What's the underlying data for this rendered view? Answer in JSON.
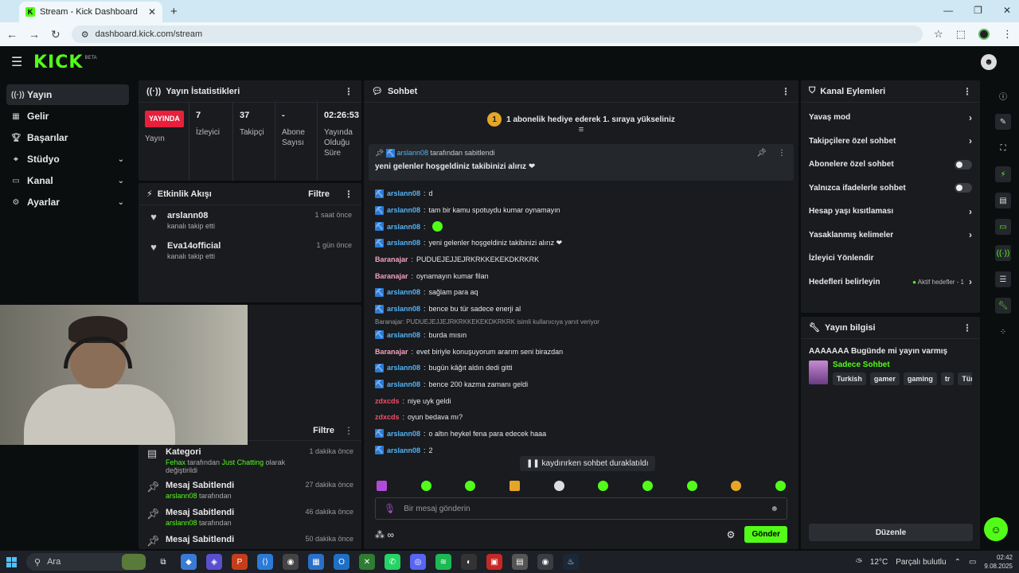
{
  "browser": {
    "tab_title": "Stream - Kick Dashboard",
    "url": "dashboard.kick.com/stream"
  },
  "app": {
    "logo": "KICK",
    "beta": "BETA"
  },
  "nav": {
    "items": [
      {
        "label": "Yayın",
        "icon": "broadcast-icon"
      },
      {
        "label": "Gelir",
        "icon": "revenue-icon"
      },
      {
        "label": "Başarılar",
        "icon": "trophy-icon"
      },
      {
        "label": "Stüdyo",
        "icon": "studio-icon"
      },
      {
        "label": "Kanal",
        "icon": "channel-icon"
      },
      {
        "label": "Ayarlar",
        "icon": "settings-icon"
      }
    ]
  },
  "stats": {
    "title": "Yayın İstatistikleri",
    "live_badge": "YAYINDA",
    "live_label": "Yayın",
    "viewers_value": "7",
    "viewers_label": "İzleyici",
    "followers_value": "37",
    "followers_label": "Takipçi",
    "subs_value": "-",
    "subs_label": "Abone Sayısı",
    "duration_value": "02:26:53",
    "duration_label": "Yayında Olduğu Süre"
  },
  "activity": {
    "title": "Etkinlik Akışı",
    "filter": "Filtre",
    "items": [
      {
        "name": "arslann08",
        "sub": "kanalı takip etti",
        "time": "1 saat önce"
      },
      {
        "name": "Eva14official",
        "sub": "kanalı takip etti",
        "time": "1 gün önce"
      }
    ]
  },
  "modlog": {
    "filter": "Filtre",
    "items": [
      {
        "title": "Kategori",
        "user": "Fehax",
        "mid": "tarafından",
        "highlight": "Just Chatting",
        "tail": "olarak değiştirildi",
        "time": "1 dakika önce"
      },
      {
        "title": "Mesaj Sabitlendi",
        "user": "arslann08",
        "mid": "tarafından",
        "time": "27 dakika önce"
      },
      {
        "title": "Mesaj Sabitlendi",
        "user": "arslann08",
        "mid": "tarafından",
        "time": "46 dakika önce"
      },
      {
        "title": "Mesaj Sabitlendi",
        "user": "",
        "mid": "",
        "time": "50 dakika önce"
      }
    ]
  },
  "chat": {
    "title": "Sohbet",
    "banner_number": "1",
    "banner_text": "1 abonelik hediye ederek 1. sıraya yükseliniz",
    "pinned_by_user": "arslann08",
    "pinned_by_text": "tarafından sabitlendi",
    "pinned_msg": "yeni gelenler hoşgeldiniz takibinizi alırız ❤",
    "messages": [
      {
        "user": "arslann08",
        "color": "#53b3f4",
        "text": "d"
      },
      {
        "user": "arslann08",
        "color": "#53b3f4",
        "text": "tam bir kamu spotuydu kumar oynamayın"
      },
      {
        "user": "arslann08",
        "color": "#53b3f4",
        "text": ""
      },
      {
        "user": "arslann08",
        "color": "#53b3f4",
        "text": "yeni gelenler hoşgeldiniz takibinizi alırız ❤"
      },
      {
        "user": "Baranajar",
        "color": "#f4a2b9",
        "text": "PUDUEJEJJEJRKRKKEKEKDKRKRK"
      },
      {
        "user": "Baranajar",
        "color": "#f4a2b9",
        "text": "oynamayın kumar filan"
      },
      {
        "user": "arslann08",
        "color": "#53b3f4",
        "text": "sağlam para aq"
      },
      {
        "user": "arslann08",
        "color": "#53b3f4",
        "text": "bence bu tür sadece enerji al"
      },
      {
        "reply": "Baranajar: PUDUEJEJJEJRKRKKEKEKDKRKRK isimli kullanıcıya yanıt veriyor"
      },
      {
        "user": "arslann08",
        "color": "#53b3f4",
        "text": "burda mısın"
      },
      {
        "user": "Baranajar",
        "color": "#f4a2b9",
        "text": "evet biriyle konuşuyorum ararım seni birazdan"
      },
      {
        "user": "arslann08",
        "color": "#53b3f4",
        "text": "bugün kâğıt aldın dedi gitti"
      },
      {
        "user": "arslann08",
        "color": "#53b3f4",
        "text": "bence 200 kazma zamanı geldi"
      },
      {
        "user": "zdxcds",
        "color": "#f44d6b",
        "text": "niye uyk geldi"
      },
      {
        "user": "zdxcds",
        "color": "#f44d6b",
        "text": "oyun bedava mı?"
      },
      {
        "user": "arslann08",
        "color": "#53b3f4",
        "text": "o altın heykel fena para edecek haaa"
      },
      {
        "user": "arslann08",
        "color": "#53b3f4",
        "text": "2"
      }
    ],
    "paused_text": "kaydırırken sohbet duraklatıldı",
    "input_placeholder": "Bir mesaj gönderin",
    "send_label": "Gönder"
  },
  "actions": {
    "title": "Kanal Eylemleri",
    "rows": [
      {
        "label": "Yavaş mod",
        "type": "arrow"
      },
      {
        "label": "Takipçilere özel sohbet",
        "type": "arrow"
      },
      {
        "label": "Abonelere özel sohbet",
        "type": "toggle"
      },
      {
        "label": "Yalnızca ifadelerle sohbet",
        "type": "toggle"
      },
      {
        "label": "Hesap yaşı kısıtlaması",
        "type": "arrow"
      },
      {
        "label": "Yasaklanmış kelimeler",
        "type": "arrow"
      },
      {
        "label": "İzleyici Yönlendir",
        "type": "none"
      },
      {
        "label": "Hedefleri belirleyin",
        "type": "arrow",
        "extra": "Aktif hedefler - 1"
      }
    ]
  },
  "streaminfo": {
    "title": "Yayın bilgisi",
    "stream_title": "AAAAAAA Bugünde mi yayın varmış",
    "category": "Sadece Sohbet",
    "tags": [
      "Turkish",
      "gamer",
      "gaming",
      "tr",
      "Türkç"
    ],
    "edit_label": "Düzenle"
  },
  "taskbar": {
    "search": "Ara",
    "weather": "12°C",
    "weather_text": "Parçalı bulutlu",
    "time": "02:42",
    "date": "9.08.2025"
  }
}
